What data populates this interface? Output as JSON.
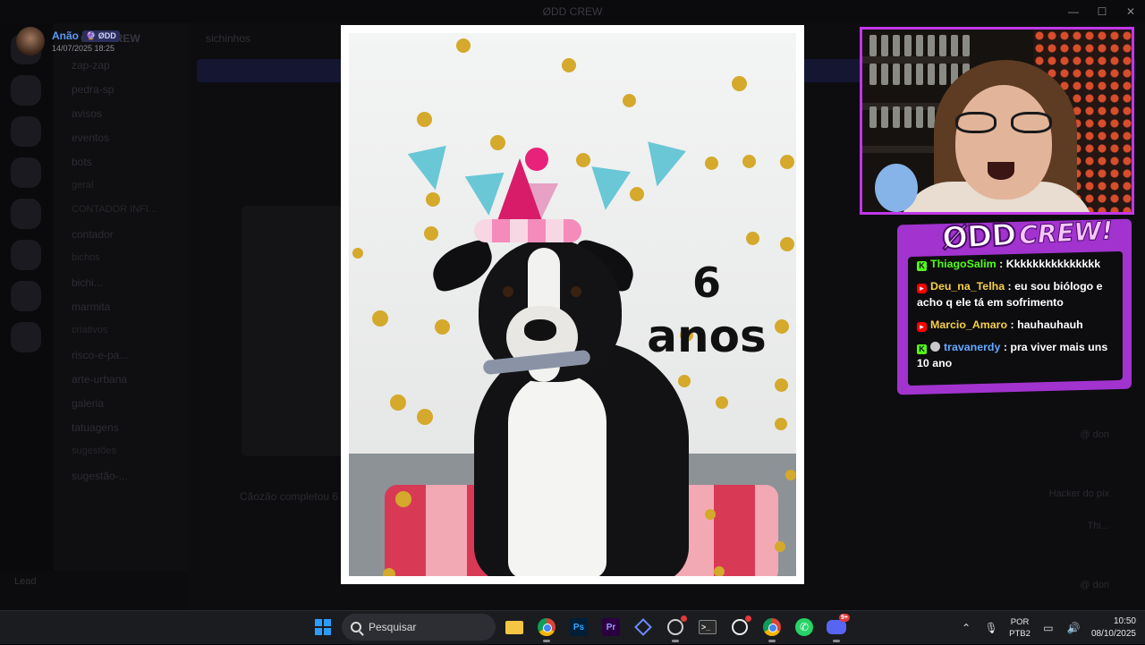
{
  "window": {
    "title": "ØDD CREW",
    "minimize": "—",
    "maximize": "☐",
    "close": "✕"
  },
  "poster": {
    "name": "Anão",
    "tag": "🔮 ØDD",
    "date": "14/07/2025 18:25"
  },
  "photo": {
    "age_number": "6",
    "age_word": "anos"
  },
  "background": {
    "server_name": "ØDD CREW",
    "channel_header": "sichinhos",
    "channels": [
      {
        "label": "zap-zap",
        "cat": false
      },
      {
        "label": "pedra-sp",
        "cat": false
      },
      {
        "label": "avisos",
        "cat": false
      },
      {
        "label": "eventos",
        "cat": false
      },
      {
        "label": "bots",
        "cat": false
      },
      {
        "label": "geral",
        "cat": true
      },
      {
        "label": "CONTADOR INFI...",
        "cat": true
      },
      {
        "label": "contador",
        "cat": false
      },
      {
        "label": "bichos",
        "cat": true
      },
      {
        "label": "bichi...",
        "cat": false
      },
      {
        "label": "marmita",
        "cat": false
      },
      {
        "label": "criativos",
        "cat": true
      },
      {
        "label": "risco-e-pa...",
        "cat": false
      },
      {
        "label": "arte-urbana",
        "cat": false
      },
      {
        "label": "galeria",
        "cat": false
      },
      {
        "label": "tatuagens",
        "cat": false
      },
      {
        "label": "sugestões",
        "cat": true
      },
      {
        "label": "sugestão-...",
        "cat": false
      }
    ],
    "user": "Lead",
    "caption": "Cãozão completou 6",
    "right_items": [
      "@ don",
      "Hacker do pix",
      "Thi...",
      "@ don"
    ]
  },
  "chat": {
    "brand_main": "ØDD",
    "brand_sub": "CREW!",
    "messages": [
      {
        "platform": "kick",
        "badge": "",
        "user": "ThiagoSalim",
        "color": "#53fc18",
        "text": "Kkkkkkkkkkkkkkk"
      },
      {
        "platform": "youtube",
        "badge": "",
        "user": "Deu_na_Telha",
        "color": "#f7d046",
        "text": "eu sou biólogo e acho q ele tá em sofrimento"
      },
      {
        "platform": "youtube",
        "badge": "",
        "user": "Marcio_Amaro",
        "color": "#f7d046",
        "text": "hauhauhauh"
      },
      {
        "platform": "kick",
        "badge": "round",
        "user": "travanerdy",
        "color": "#63a8ff",
        "text": "pra viver mais uns 10 ano"
      }
    ]
  },
  "taskbar": {
    "search_placeholder": "Pesquisar",
    "apps": [
      "file-explorer",
      "chrome",
      "photoshop",
      "premiere",
      "app-diamond",
      "app-record",
      "terminal",
      "app-monitor",
      "chrome-profile",
      "whatsapp",
      "discord"
    ],
    "ps_label": "Ps",
    "pr_label": "Pr",
    "discord_notif": "9+",
    "chrome_notif": "",
    "lang_top": "POR",
    "lang_bottom": "PTB2",
    "time": "10:50",
    "date": "08/10/2025"
  }
}
